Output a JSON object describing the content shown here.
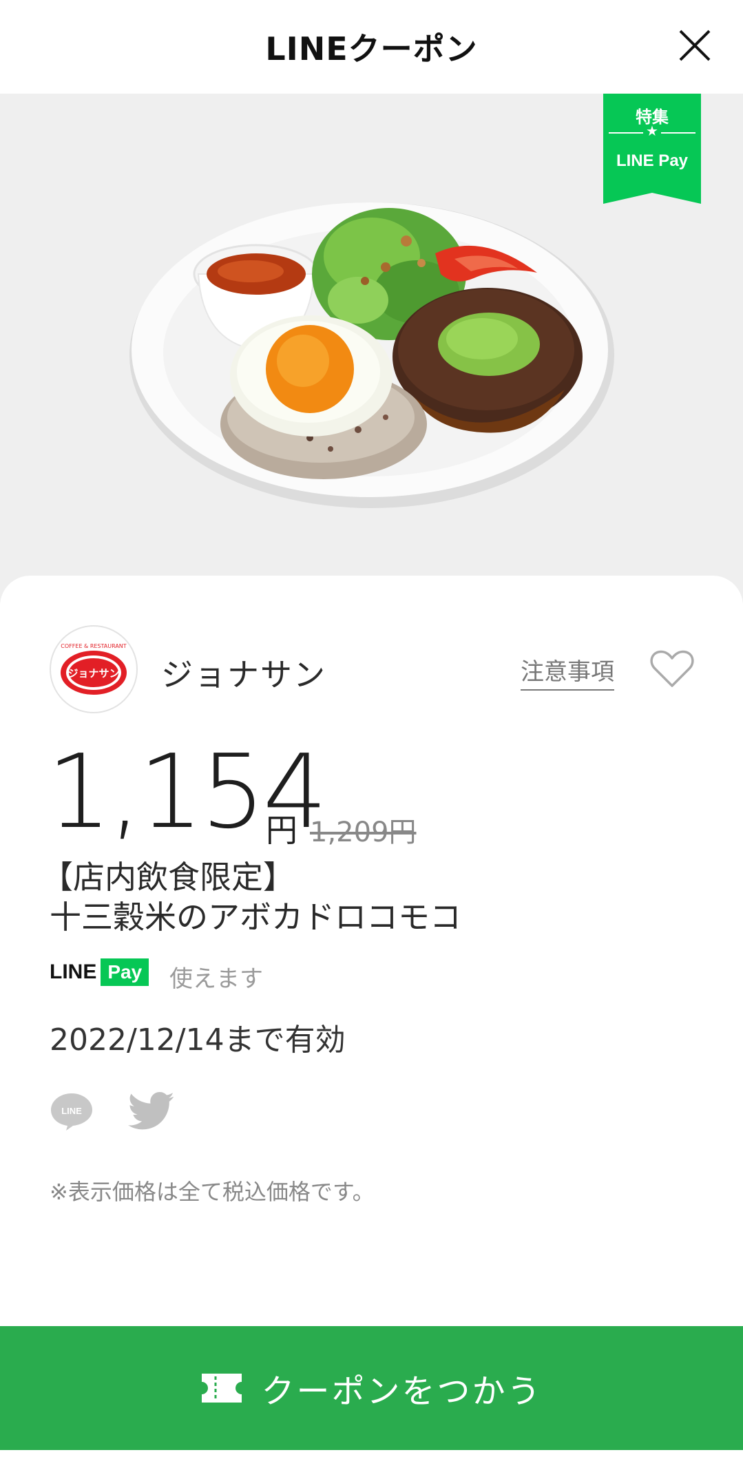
{
  "header": {
    "title": "LINEクーポン",
    "close_icon": "close-icon"
  },
  "hero": {
    "image_icon": "food-photo",
    "badge": {
      "title": "特集",
      "star": "★",
      "pay": "LINE Pay",
      "color": "#06c755"
    }
  },
  "brand": {
    "logo_text": "ジョナサン",
    "logo_ring_text": "COFFEE & RESTAURANT",
    "name": "ジョナサン",
    "notice_link": "注意事項",
    "favorite_icon": "heart-icon"
  },
  "price": {
    "current": "1,154",
    "unit": "円",
    "original": "1,209円"
  },
  "coupon": {
    "title_line1": "【店内飲食限定】",
    "title_line2": "十三穀米のアボカドロコモコ"
  },
  "payment": {
    "logo_line": "LINE",
    "logo_pay": "Pay",
    "usable_text": "使えます"
  },
  "validity": "2022/12/14まで有効",
  "share": {
    "line_icon": "line-share-icon",
    "line_icon_text": "LINE",
    "twitter_icon": "twitter-icon"
  },
  "tax_note": "※表示価格は全て税込価格です。",
  "cta": {
    "label": "クーポンをつかう",
    "icon": "ticket-icon",
    "color": "#2aac4e"
  }
}
